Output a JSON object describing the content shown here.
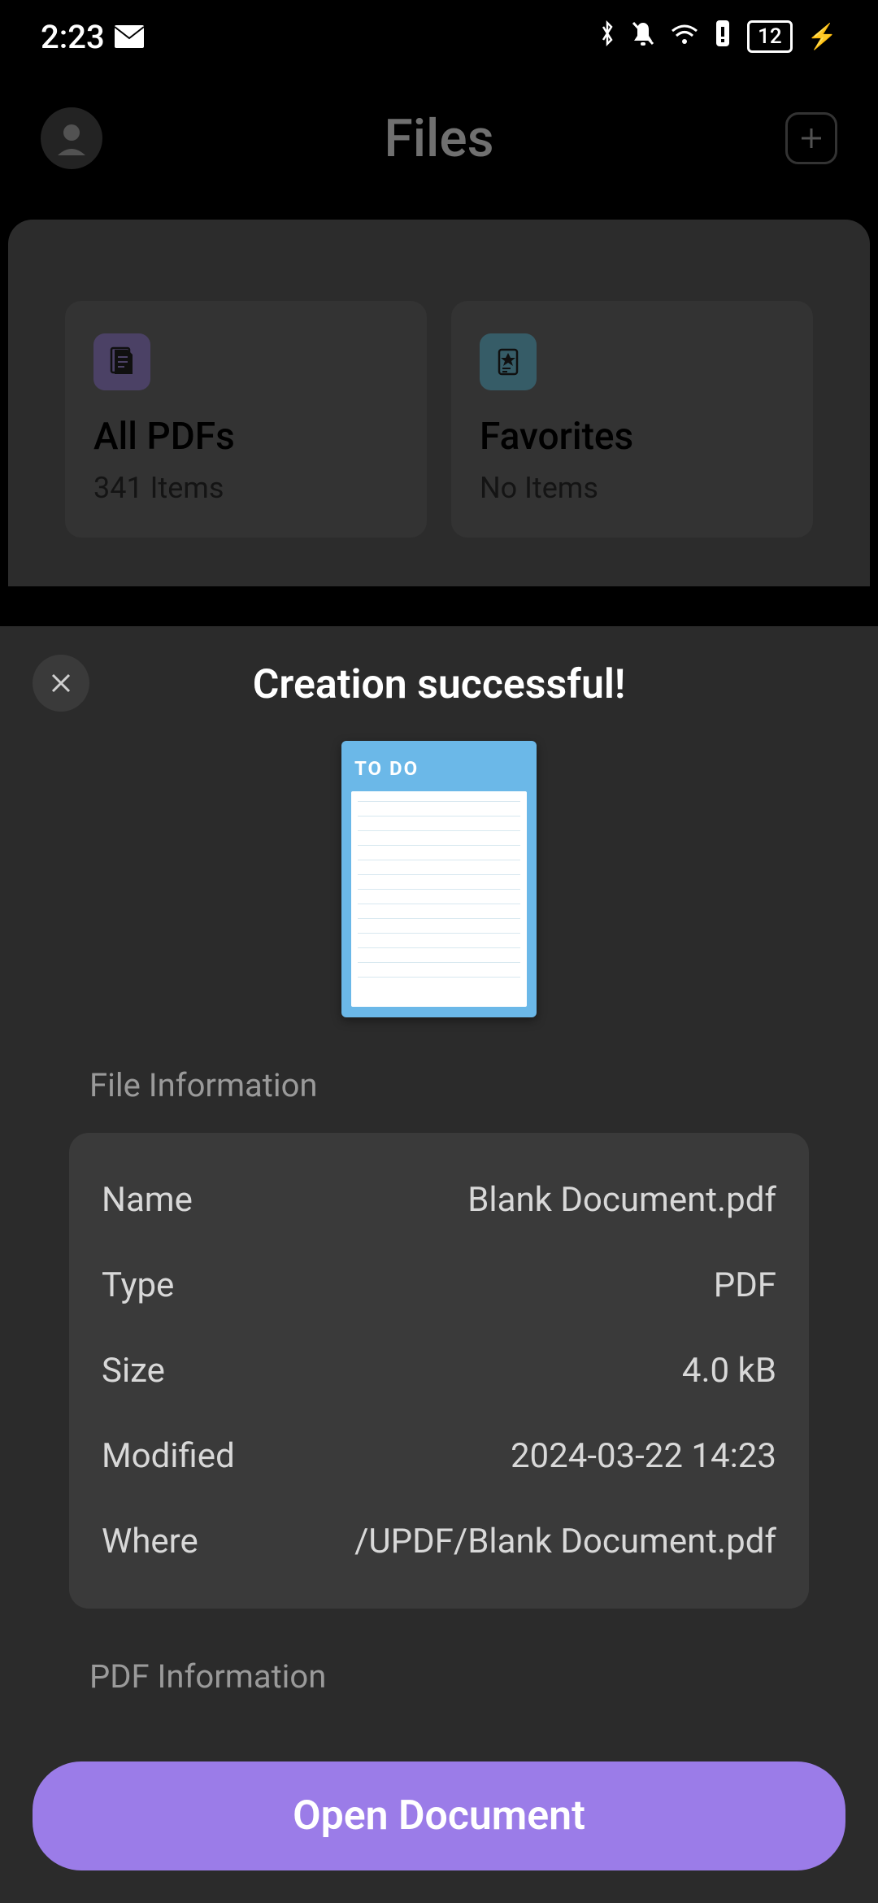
{
  "status_bar": {
    "time": "2:23",
    "battery": "12"
  },
  "header": {
    "title": "Files"
  },
  "cards": {
    "all_pdfs": {
      "title": "All PDFs",
      "subtitle": "341 Items"
    },
    "favorites": {
      "title": "Favorites",
      "subtitle": "No Items"
    }
  },
  "modal": {
    "title": "Creation successful!",
    "preview_label": "TO DO",
    "file_info_label": "File Information",
    "pdf_info_label": "PDF Information",
    "rows": {
      "name": {
        "label": "Name",
        "value": "Blank Document.pdf"
      },
      "type": {
        "label": "Type",
        "value": "PDF"
      },
      "size": {
        "label": "Size",
        "value": "4.0 kB"
      },
      "modified": {
        "label": "Modified",
        "value": "2024-03-22 14:23"
      },
      "where": {
        "label": "Where",
        "value": "/UPDF/Blank Document.pdf"
      }
    },
    "open_button": "Open Document"
  }
}
